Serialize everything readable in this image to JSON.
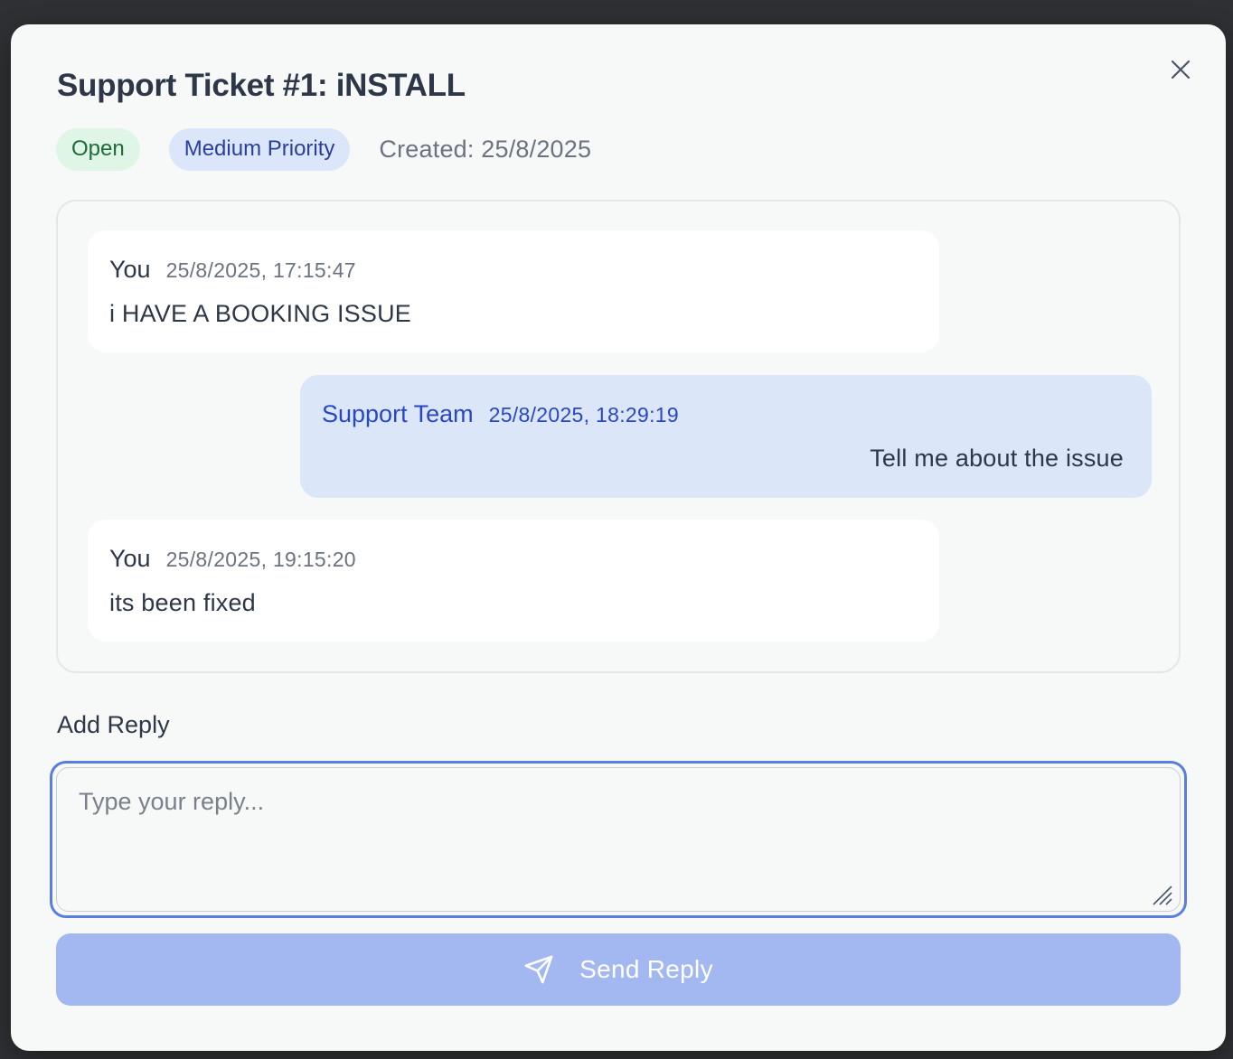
{
  "modal": {
    "title": "Support Ticket #1: iNSTALL",
    "status_badge": "Open",
    "priority_badge": "Medium Priority",
    "created": "Created: 25/8/2025"
  },
  "messages": [
    {
      "sender": "You",
      "timestamp": "25/8/2025, 17:15:47",
      "text": "i HAVE A BOOKING ISSUE",
      "role": "user"
    },
    {
      "sender": "Support Team",
      "timestamp": "25/8/2025, 18:29:19",
      "text": "Tell me about the issue",
      "role": "support"
    },
    {
      "sender": "You",
      "timestamp": "25/8/2025, 19:15:20",
      "text": "its been fixed",
      "role": "user"
    }
  ],
  "reply": {
    "label": "Add Reply",
    "placeholder": "Type your reply...",
    "value": "",
    "send_label": "Send Reply"
  },
  "icons": {
    "close": "close-icon",
    "send": "send-icon",
    "resize": "resize-grip-icon"
  },
  "colors": {
    "open_badge_bg": "#dff5e6",
    "open_badge_text": "#1f6b3a",
    "priority_badge_bg": "#dbe6fb",
    "priority_badge_text": "#2a3f9c",
    "support_bubble": "#dce6f9",
    "support_text": "#2747c7",
    "send_button": "#a3b8f0",
    "focus_ring": "#5a7ee0"
  }
}
